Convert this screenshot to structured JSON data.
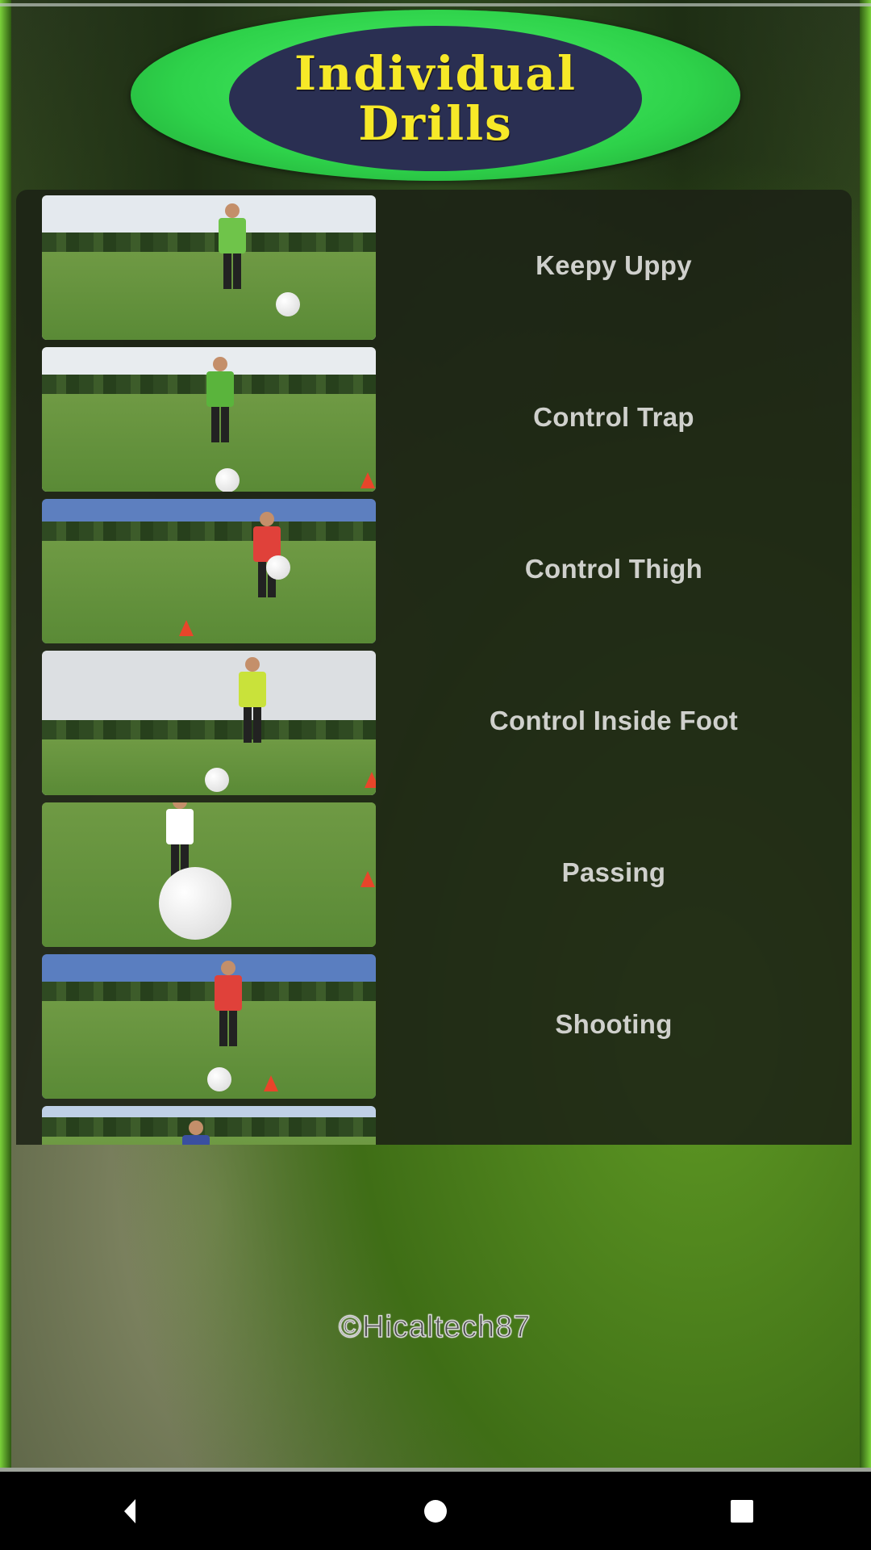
{
  "header": {
    "title_line1": "Individual",
    "title_line2": "Drills"
  },
  "drills": [
    {
      "label": "Keepy Uppy",
      "thumbnail": "video-thumbnail",
      "bib_color": "#6fc44a"
    },
    {
      "label": "Control Trap",
      "thumbnail": "video-thumbnail",
      "bib_color": "#5ab43c"
    },
    {
      "label": "Control Thigh",
      "thumbnail": "video-thumbnail",
      "bib_color": "#e0413a"
    },
    {
      "label": "Control Inside Foot",
      "thumbnail": "video-thumbnail",
      "bib_color": "#c9e23a"
    },
    {
      "label": "Passing",
      "thumbnail": "video-thumbnail",
      "bib_color": "#ffffff"
    },
    {
      "label": "Shooting",
      "thumbnail": "video-thumbnail",
      "bib_color": "#e0413a"
    },
    {
      "label": "",
      "thumbnail": "video-thumbnail",
      "bib_color": "#3a4fa0"
    }
  ],
  "watermark": "©Hicaltech87",
  "navbar": {
    "back": "back-icon",
    "home": "home-icon",
    "recents": "recents-icon"
  },
  "colors": {
    "logo_green": "#2ed24a",
    "logo_navy": "#2a2f52",
    "logo_text": "#f7e928",
    "label_text": "#cfd0cc"
  }
}
